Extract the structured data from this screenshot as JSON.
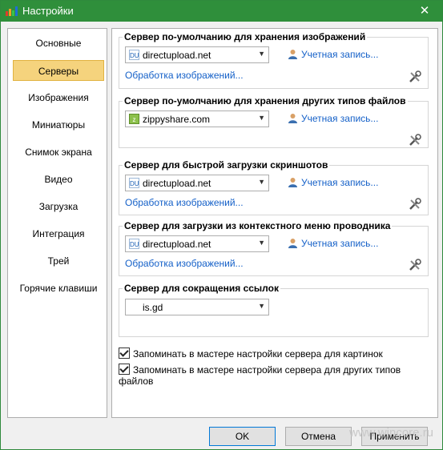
{
  "window": {
    "title": "Настройки",
    "close_glyph": "✕"
  },
  "nav": {
    "items": [
      {
        "label": "Основные"
      },
      {
        "label": "Серверы",
        "active": true
      },
      {
        "label": "Изображения"
      },
      {
        "label": "Миниатюры"
      },
      {
        "label": "Снимок экрана"
      },
      {
        "label": "Видео"
      },
      {
        "label": "Загрузка"
      },
      {
        "label": "Интеграция"
      },
      {
        "label": "Трей"
      },
      {
        "label": "Горячие клавиши"
      }
    ]
  },
  "groups": [
    {
      "title": "Сервер по-умолчанию для хранения изображений",
      "server": "directupload.net",
      "icon": "directupload-icon",
      "account": "Учетная запись...",
      "processing": "Обработка изображений..."
    },
    {
      "title": "Сервер по-умолчанию для хранения других типов файлов",
      "server": "zippyshare.com",
      "icon": "zippyshare-icon",
      "account": "Учетная запись..."
    },
    {
      "title": "Сервер для быстрой загрузки скриншотов",
      "server": "directupload.net",
      "icon": "directupload-icon",
      "account": "Учетная запись...",
      "processing": "Обработка изображений..."
    },
    {
      "title": "Сервер для загрузки из контекстного меню проводника",
      "server": "directupload.net",
      "icon": "directupload-icon",
      "account": "Учетная запись...",
      "processing": "Обработка изображений..."
    },
    {
      "title": "Сервер для сокращения ссылок",
      "server": "is.gd"
    }
  ],
  "icon_text": {
    "directupload": "DU"
  },
  "checkboxes": [
    {
      "label": "Запоминать в мастере настройки сервера для картинок",
      "checked": true
    },
    {
      "label": "Запоминать в мастере настройки сервера для других типов файлов",
      "checked": true
    }
  ],
  "buttons": {
    "ok": "OK",
    "cancel": "Отмена",
    "apply": "Применить"
  },
  "watermark": "www.wincore.ru",
  "colors": {
    "titlebar": "#2f8f3b",
    "nav_active": "#f5d37d",
    "link": "#1460c8"
  }
}
